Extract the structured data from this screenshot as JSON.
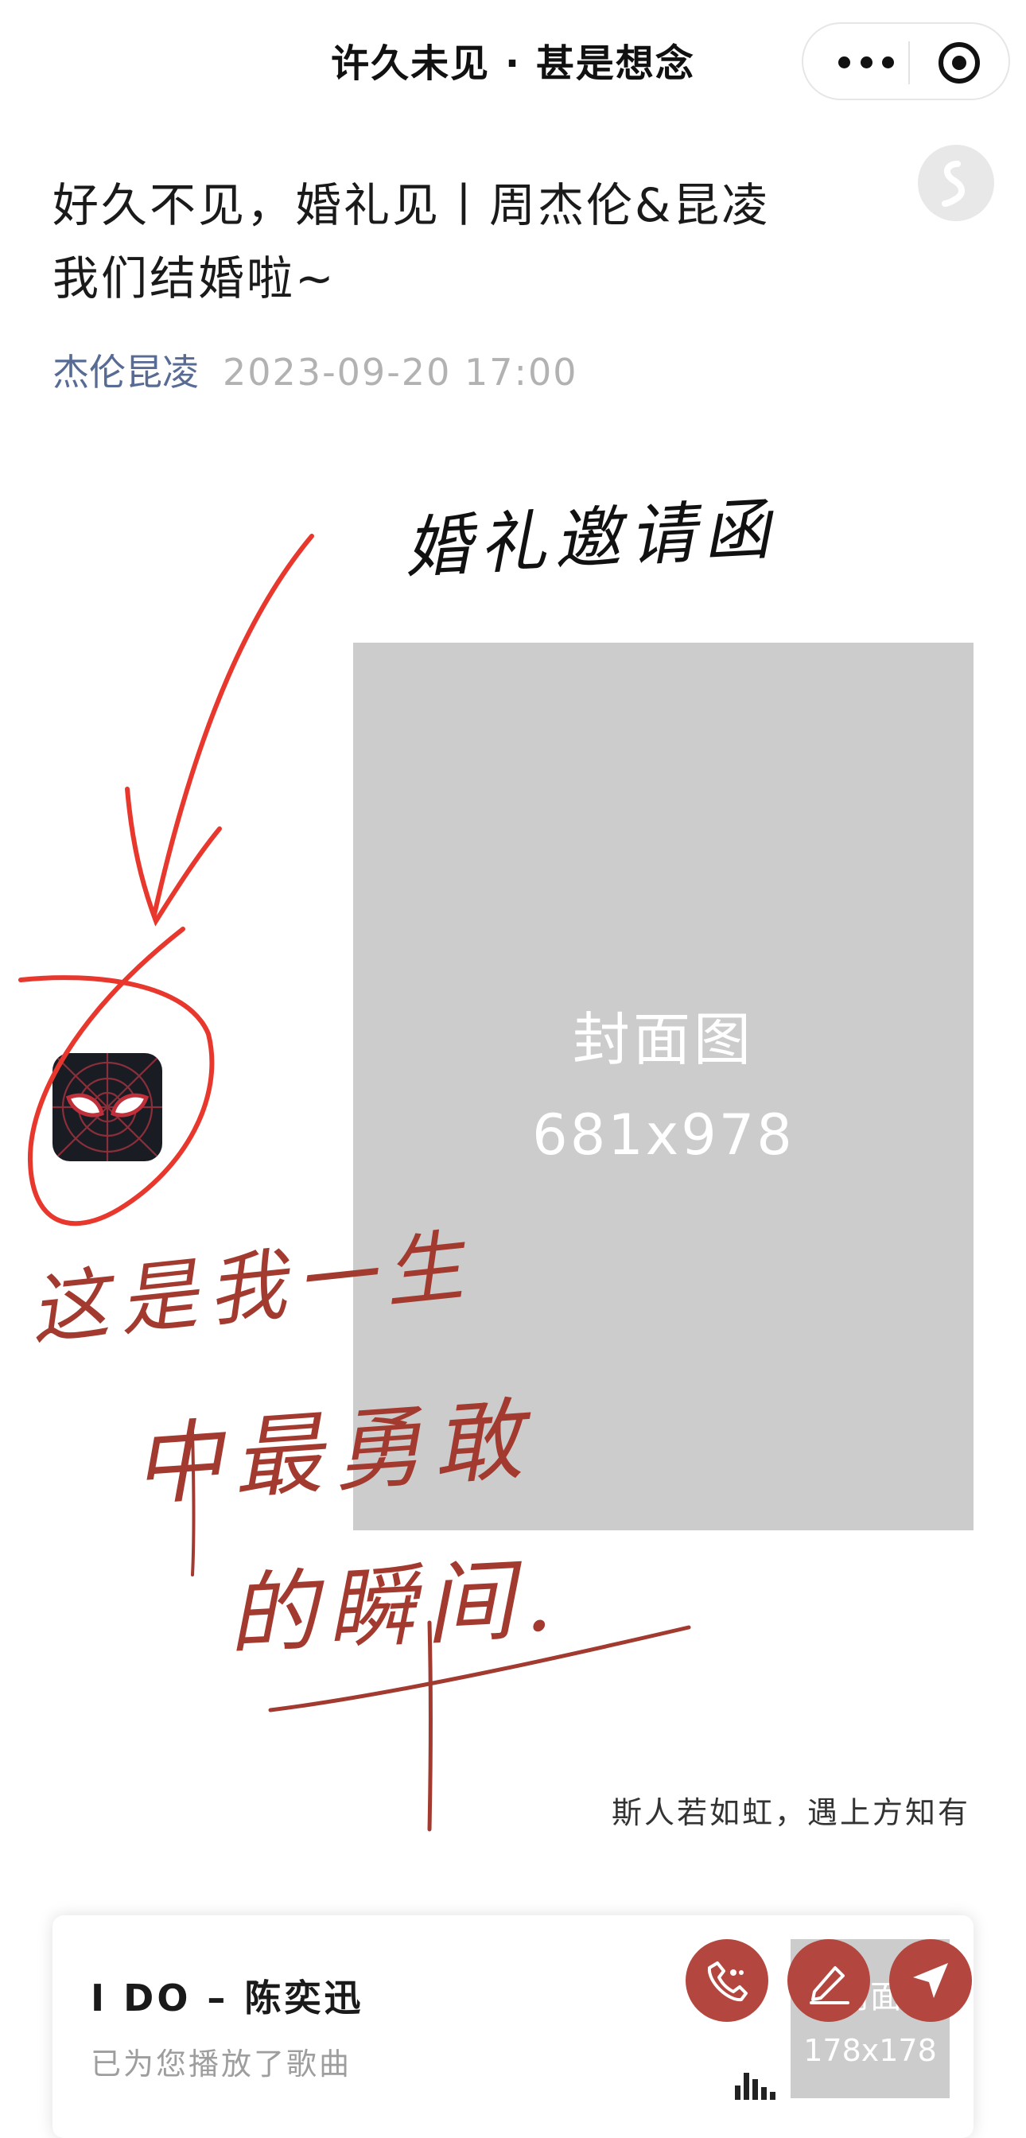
{
  "navbar": {
    "title": "许久未见 · 甚是想念",
    "more_icon": "more-dots-icon",
    "close_icon": "target-circle-icon"
  },
  "article": {
    "title_line1": "好久不见，婚礼见丨周杰伦&昆凌",
    "title_line2": "我们结婚啦~",
    "author": "杰伦昆凌",
    "date": "2023-09-20 17:00"
  },
  "cover": {
    "label": "封面图",
    "size": "681x978"
  },
  "handwriting": {
    "top": "婚礼邀请函",
    "line1": "这是我一生",
    "line2": "中最勇敢",
    "line3": "的瞬间."
  },
  "quote": "斯人若如虹，遇上方知有",
  "music": {
    "song": "I DO – 陈奕迅",
    "status": "已为您播放了歌曲",
    "thumb_label": "封面",
    "thumb_size": "178x178"
  },
  "colors": {
    "accent_red": "#b3473f",
    "author_blue": "#576b95",
    "placeholder_gray": "#cccccc",
    "annotation_red": "#e8382e",
    "handwriting_brown": "#a33a2f"
  }
}
